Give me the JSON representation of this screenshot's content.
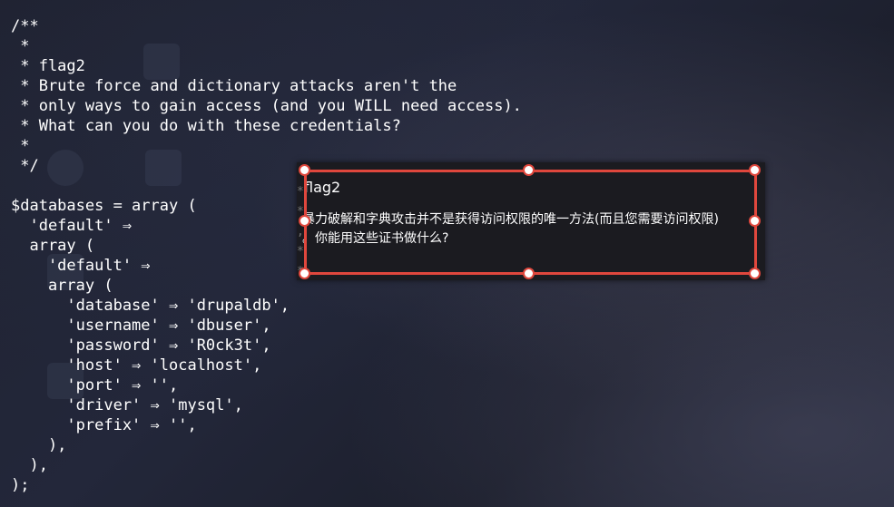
{
  "terminal": {
    "lines": [
      "/**",
      " *",
      " * flag2",
      " * Brute force and dictionary attacks aren't the",
      " * only ways to gain access (and you WILL need access).",
      " * What can you do with these credentials?",
      " *",
      " */",
      "",
      "$databases = array (",
      "  'default' ⇒",
      "  array (",
      "    'default' ⇒",
      "    array (",
      "      'database' ⇒ 'drupaldb',",
      "      'username' ⇒ 'dbuser',",
      "      'password' ⇒ 'R0ck3t',",
      "      'host' ⇒ 'localhost',",
      "      'port' ⇒ '',",
      "      'driver' ⇒ 'mysql',",
      "      'prefix' ⇒ '',",
      "    ),",
      "  ),",
      ");"
    ]
  },
  "translation_popup": {
    "gutter": "*\n*\n,\n*\n*",
    "title": "flag2",
    "line1": "暴力破解和字典攻击并不是获得访问权限的唯一方法(而且您需要访问权限)",
    "line2": "。你能用这些证书做什么?"
  },
  "colors": {
    "selection_border": "#e0473d",
    "text": "#ffffff",
    "popup_bg": "#1b1b20"
  }
}
